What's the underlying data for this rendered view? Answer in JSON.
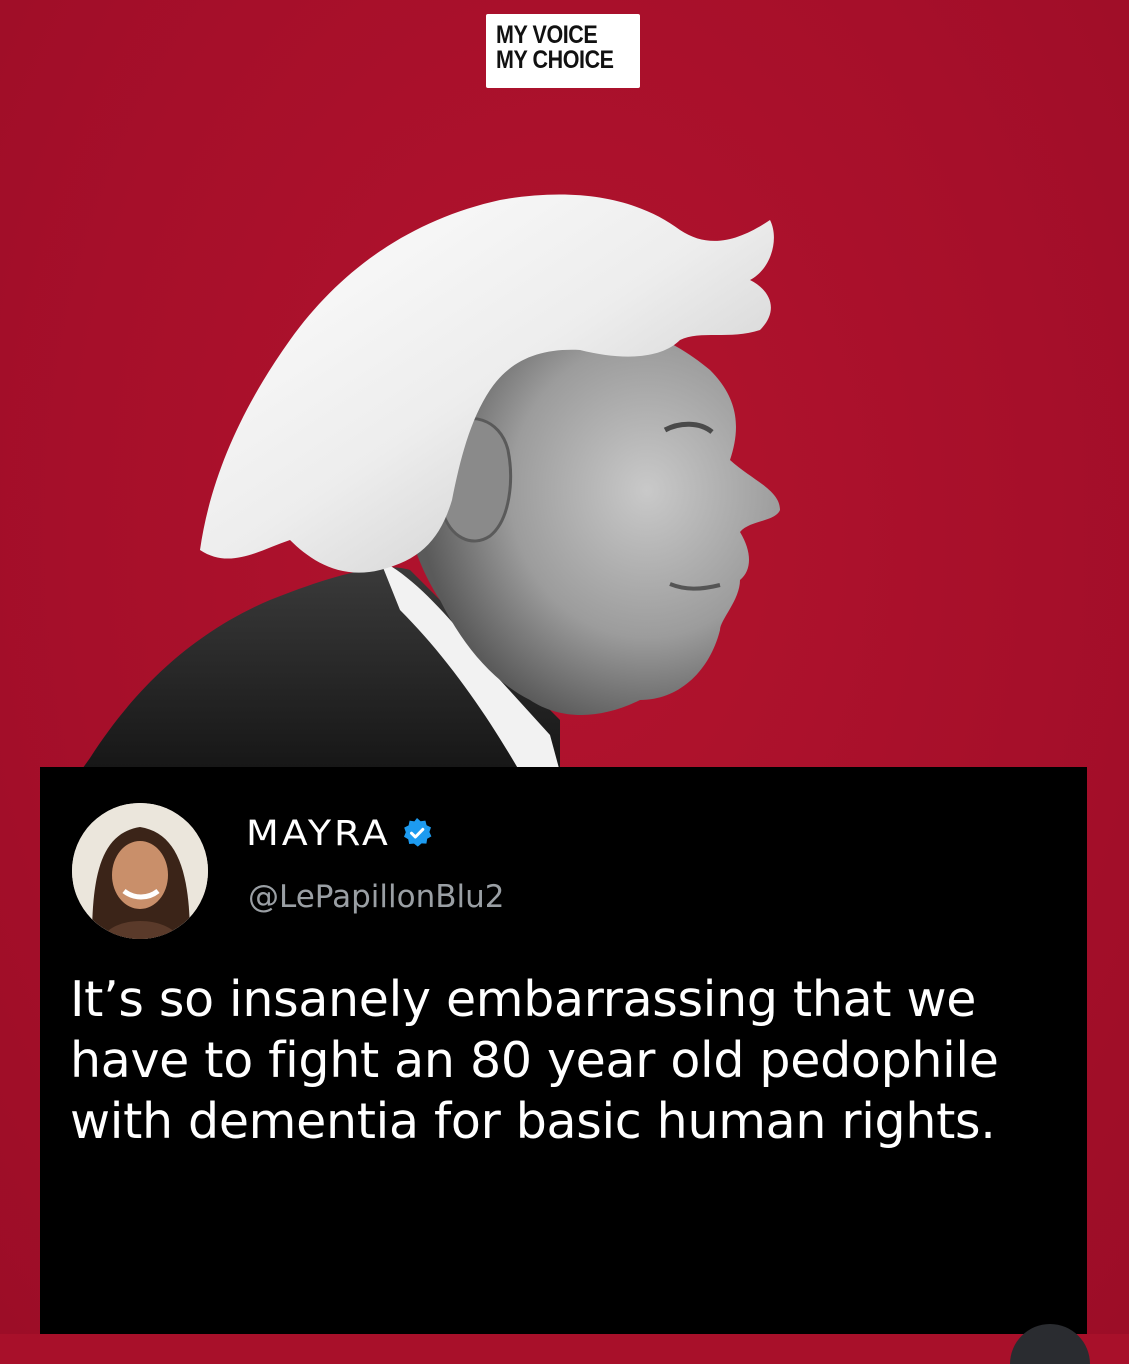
{
  "poster": {
    "background_color": "#a8102a",
    "logo": {
      "line1": "MY VOICE",
      "line2": "MY CHOICE"
    },
    "portrait": {
      "description_icon": "grayscale-profile-portrait"
    }
  },
  "tweet": {
    "display_name": "MAYRA",
    "verified_icon": "verified-badge-icon",
    "verified_color": "#1d9bf0",
    "handle": "@LePapillonBlu2",
    "text": "It’s so insanely embarrassing that we have to fight an 80 year old pedophile with dementia for basic human rights.",
    "card_color": "#000000"
  }
}
